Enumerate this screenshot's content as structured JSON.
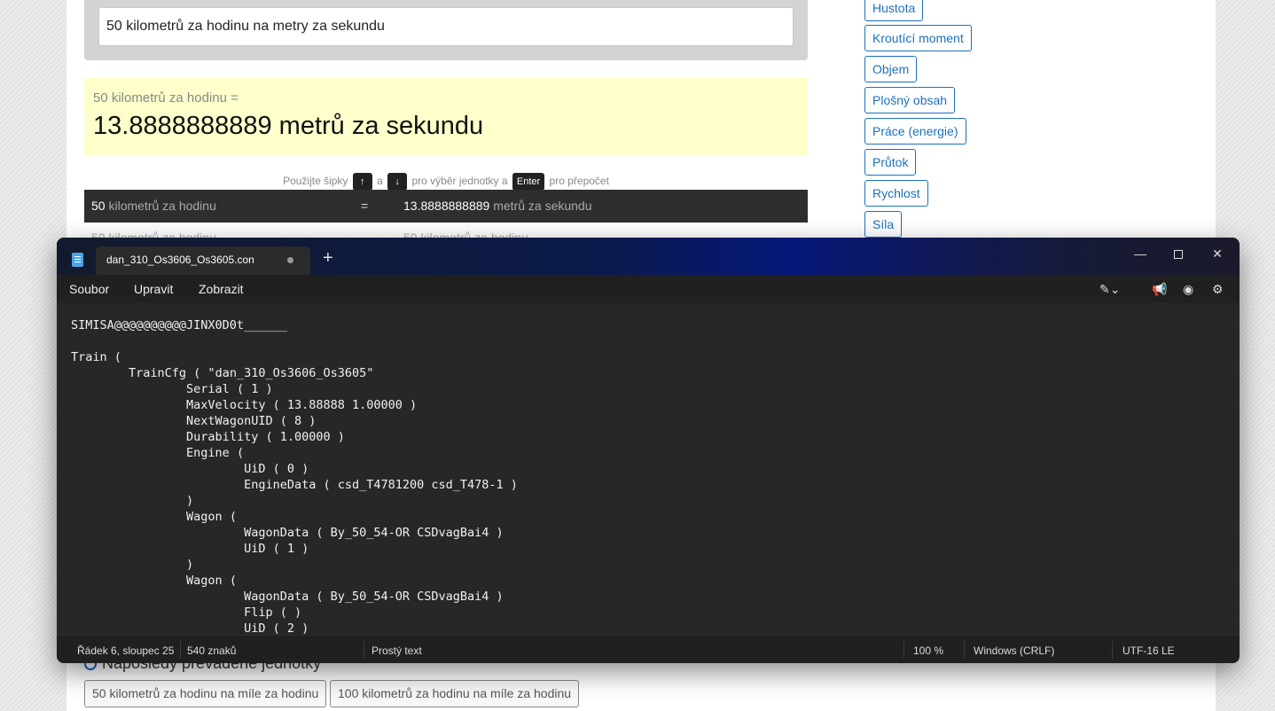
{
  "converter": {
    "query": "50 kilometrů za hodinu na metry za sekundu",
    "result_label": "50 kilometrů za hodinu =",
    "result_value": "13.8888888889 metrů za sekundu",
    "hint": {
      "use": "Použijte šipky",
      "and": "a",
      "select": "pro výběr jednotky a",
      "enter_key": "Enter",
      "recalc": "pro přepočet"
    },
    "row": {
      "left_value": "50",
      "left_unit": "kilometrů za hodinu",
      "equals": "=",
      "right_value": "13.8888888889",
      "right_unit": "metrů za sekundu"
    },
    "row2": {
      "left_value": "50",
      "left_unit": "kilometrů za hodinu",
      "right_value": "50",
      "right_unit": "kilometrů za hodinu"
    },
    "recent_heading": "Naposledy převáděné jednotky",
    "recent": [
      "50 kilometrů za hodinu na míle za hodinu",
      "100 kilometrů za hodinu na míle za hodinu"
    ]
  },
  "categories": [
    "Hustota",
    "Kroutící moment",
    "Objem",
    "Plošný obsah",
    "Práce (energie)",
    "Průtok",
    "Rychlost",
    "Síla"
  ],
  "notepad": {
    "tab_title": "dan_310_Os3606_Os3605.con",
    "new_tab": "+",
    "menu": {
      "file": "Soubor",
      "edit": "Upravit",
      "view": "Zobrazit"
    },
    "content": "SIMISA@@@@@@@@@@JINX0D0t______\n\nTrain (\n\tTrainCfg ( \"dan_310_Os3606_Os3605\"\n\t\tSerial ( 1 )\n\t\tMaxVelocity ( 13.88888 1.00000 )\n\t\tNextWagonUID ( 8 )\n\t\tDurability ( 1.00000 )\n\t\tEngine (\n\t\t\tUiD ( 0 )\n\t\t\tEngineData ( csd_T4781200 csd_T478-1 )\n\t\t)\n\t\tWagon (\n\t\t\tWagonData ( By_50_54-OR CSDvagBai4 )\n\t\t\tUiD ( 1 )\n\t\t)\n\t\tWagon (\n\t\t\tWagonData ( By_50_54-OR CSDvagBai4 )\n\t\t\tFlip ( )\n\t\t\tUiD ( 2 )",
    "status": {
      "position": "Řádek 6, sloupec 25",
      "chars": "540 znaků",
      "format": "Prostý text",
      "zoom": "100 %",
      "line_endings": "Windows (CRLF)",
      "encoding": "UTF-16 LE"
    }
  },
  "colors": {
    "result_bg": "#ffffcc",
    "category_accent": "#1e70b8",
    "notepad_bg": "#272727"
  }
}
